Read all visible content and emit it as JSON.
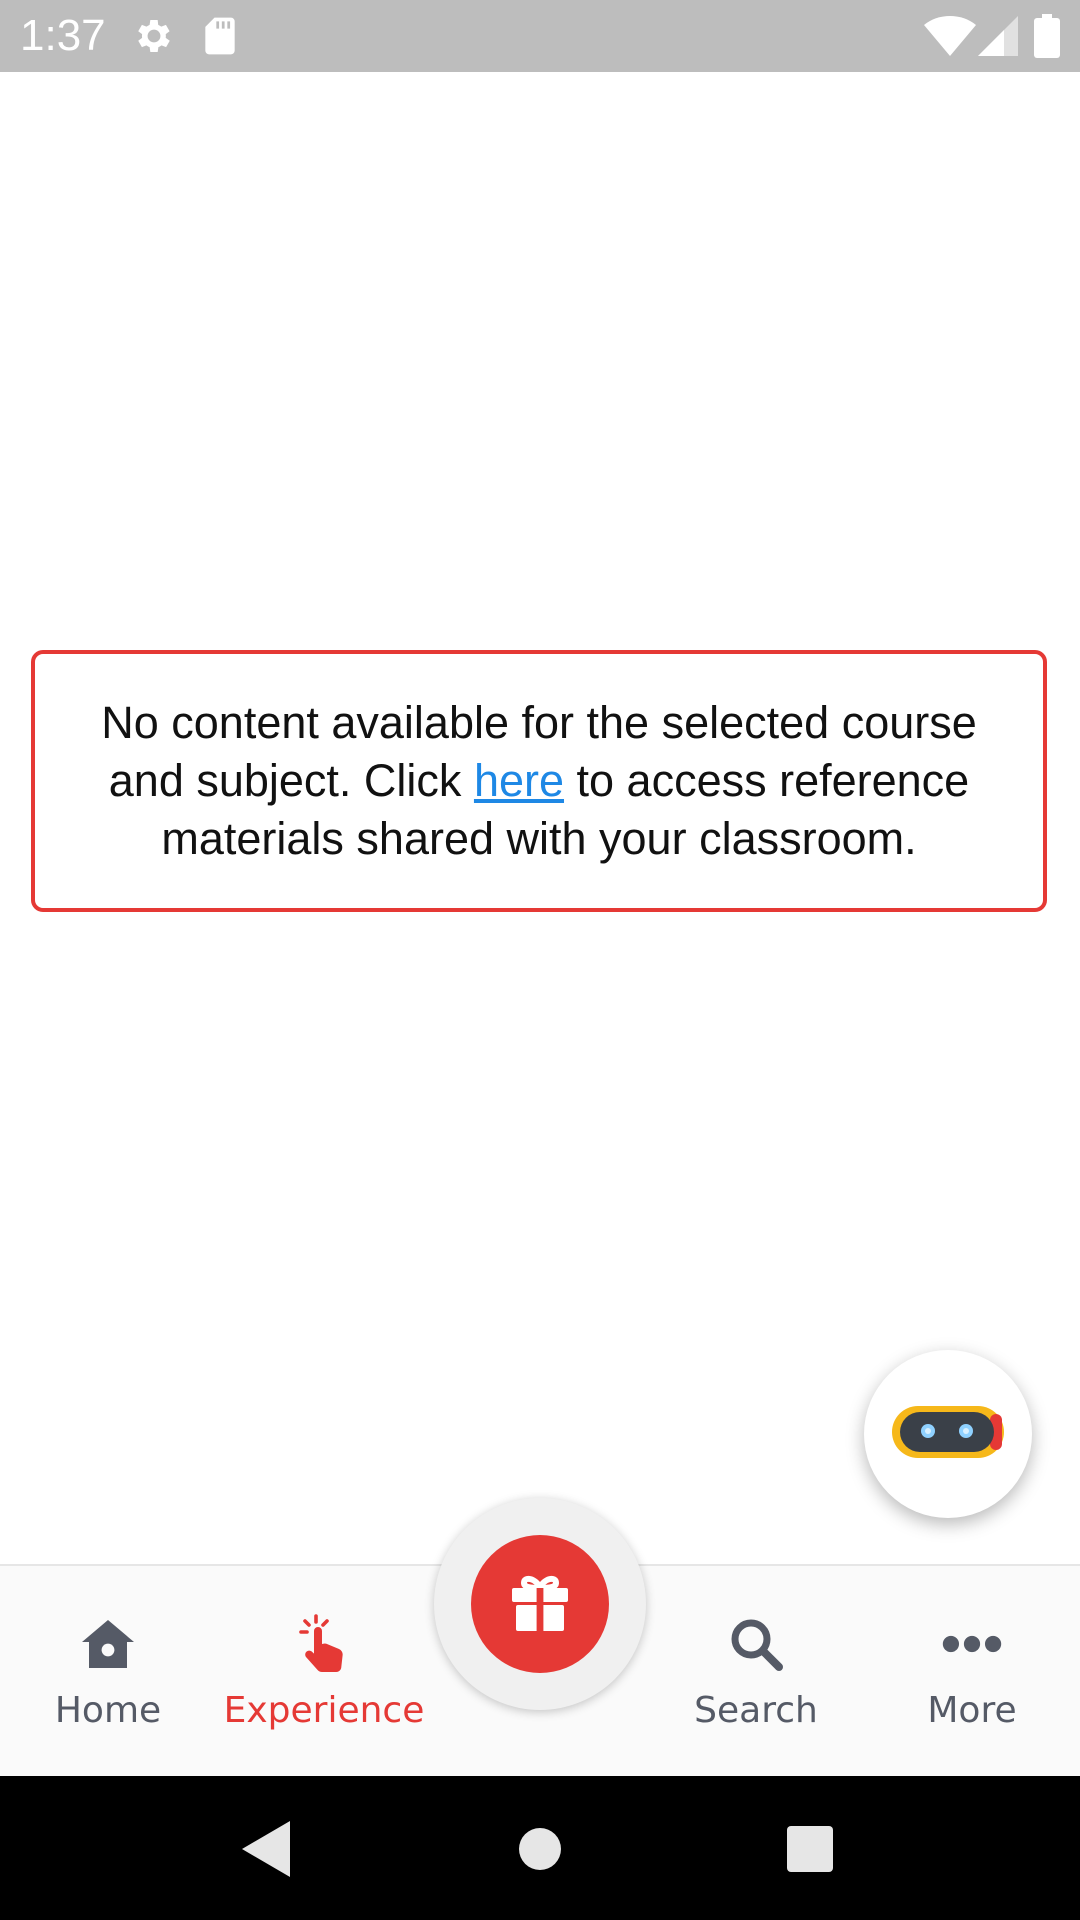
{
  "status_bar": {
    "time": "1:37",
    "icons": [
      "settings-icon",
      "sd-card-icon",
      "wifi-icon",
      "cell-signal-icon",
      "battery-icon"
    ]
  },
  "empty_state": {
    "text_before": "No content available for the selected course and subject. Click ",
    "link_text": "here",
    "text_after": " to access reference materials shared with your classroom."
  },
  "assistant": {
    "icon": "robot-icon"
  },
  "bottom_nav": {
    "items": [
      {
        "label": "Home",
        "icon": "home-icon"
      },
      {
        "label": "Experience",
        "icon": "tap-hand-icon",
        "active": true
      },
      {
        "label": "",
        "icon": "gift-icon"
      },
      {
        "label": "Search",
        "icon": "search-icon"
      },
      {
        "label": "More",
        "icon": "more-dots-icon"
      }
    ]
  },
  "system_nav": {
    "icons": [
      "back-icon",
      "home-circle-icon",
      "recents-icon"
    ]
  },
  "colors": {
    "accent": "#e53935",
    "link": "#1e88e5",
    "nav_inactive": "#555a66",
    "status_bar": "#bdbdbd"
  }
}
